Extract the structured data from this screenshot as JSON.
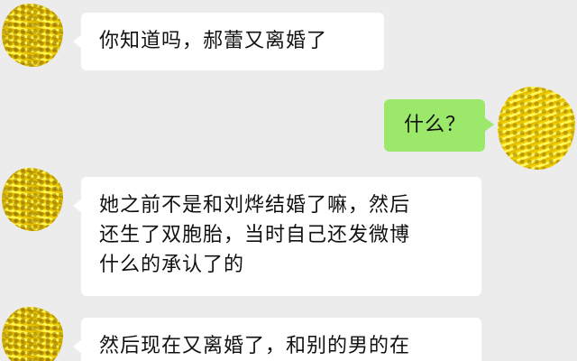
{
  "messages": [
    {
      "side": "left",
      "text": "你知道吗，郝蕾又离婚了"
    },
    {
      "side": "right",
      "text": "什么？"
    },
    {
      "side": "left",
      "text": "她之前不是和刘烨结婚了嘛，然后\n还生了双胞胎，当时自己还发微博\n什么的承认了的"
    },
    {
      "side": "left",
      "text": "然后现在又离婚了，和别的男的在"
    }
  ],
  "colors": {
    "background": "#ececec",
    "incoming_bubble": "#ffffff",
    "outgoing_bubble": "#9be86b",
    "avatar_scribble": "#f4e23a"
  },
  "icons": {
    "avatar": "avatar-scribbled"
  }
}
